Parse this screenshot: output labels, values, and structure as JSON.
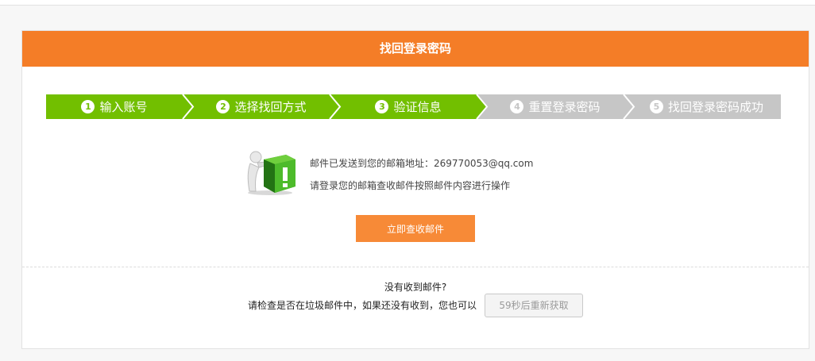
{
  "header": {
    "title": "找回登录密码"
  },
  "steps": [
    {
      "num": "1",
      "label": "输入账号",
      "state": "done"
    },
    {
      "num": "2",
      "label": "选择找回方式",
      "state": "done"
    },
    {
      "num": "3",
      "label": "验证信息",
      "state": "done"
    },
    {
      "num": "4",
      "label": "重置登录密码",
      "state": "todo"
    },
    {
      "num": "5",
      "label": "找回登录密码成功",
      "state": "todo"
    }
  ],
  "colors": {
    "accent": "#f47d27",
    "step_done": "#72bf00",
    "step_todo": "#c6c6c6"
  },
  "message": {
    "sent_prefix": "邮件已发送到您的邮箱地址：",
    "email": "269770053@qq.com",
    "instruction": "请登录您的邮箱查收邮件按照邮件内容进行操作",
    "illustration_icon": "warning-figure-icon"
  },
  "check_button": {
    "label": "立即查收邮件"
  },
  "footer": {
    "question": "没有收到邮件?",
    "hint": "请检查是否在垃圾邮件中，如果还没有收到，您也可以",
    "retry_label": "59秒后重新获取"
  }
}
